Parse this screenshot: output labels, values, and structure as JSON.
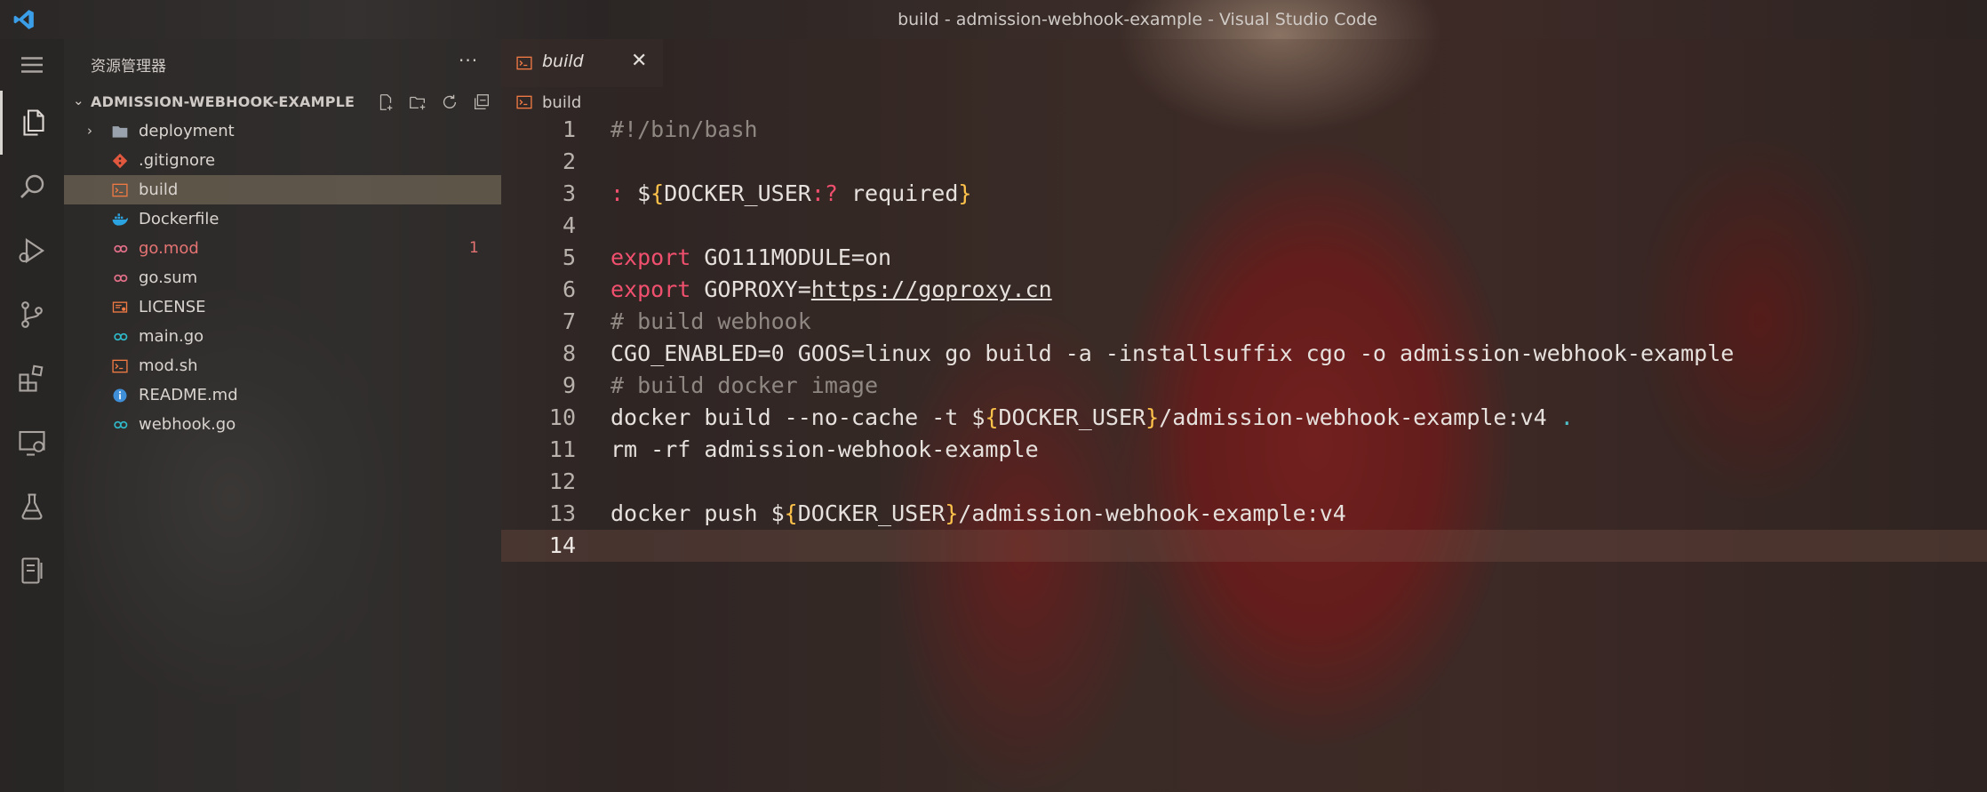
{
  "window": {
    "title": "build - admission-webhook-example - Visual Studio Code"
  },
  "sidebar": {
    "title": "资源管理器",
    "more_label": "···",
    "project": "ADMISSION-WEBHOOK-EXAMPLE",
    "items": [
      {
        "label": "deployment",
        "type": "folder",
        "icon": "folder-icon"
      },
      {
        "label": ".gitignore",
        "type": "git",
        "icon": "git-icon"
      },
      {
        "label": "build",
        "type": "shell",
        "icon": "terminal-icon",
        "selected": true
      },
      {
        "label": "Dockerfile",
        "type": "docker",
        "icon": "docker-icon"
      },
      {
        "label": "go.mod",
        "type": "go-mod",
        "icon": "go-icon",
        "error": true,
        "badge": "1"
      },
      {
        "label": "go.sum",
        "type": "go-mod",
        "icon": "go-icon"
      },
      {
        "label": "LICENSE",
        "type": "license",
        "icon": "license-icon"
      },
      {
        "label": "main.go",
        "type": "go",
        "icon": "go-icon"
      },
      {
        "label": "mod.sh",
        "type": "shell",
        "icon": "terminal-icon"
      },
      {
        "label": "README.md",
        "type": "info",
        "icon": "info-icon"
      },
      {
        "label": "webhook.go",
        "type": "go",
        "icon": "go-icon"
      }
    ]
  },
  "editor": {
    "tab": {
      "label": "build",
      "close": "✕"
    },
    "breadcrumb": "build",
    "current_line": 14,
    "lines": [
      {
        "n": "1",
        "text": "#!/bin/bash"
      },
      {
        "n": "2",
        "text": ""
      },
      {
        "n": "3",
        "text": ": ${DOCKER_USER:? required}"
      },
      {
        "n": "4",
        "text": ""
      },
      {
        "n": "5",
        "text": "export GO111MODULE=on"
      },
      {
        "n": "6",
        "text": "export GOPROXY=https://goproxy.cn"
      },
      {
        "n": "7",
        "text": "# build webhook"
      },
      {
        "n": "8",
        "text": "CGO_ENABLED=0 GOOS=linux go build -a -installsuffix cgo -o admission-webhook-example"
      },
      {
        "n": "9",
        "text": "# build docker image"
      },
      {
        "n": "10",
        "text": "docker build --no-cache -t ${DOCKER_USER}/admission-webhook-example:v4 ."
      },
      {
        "n": "11",
        "text": "rm -rf admission-webhook-example"
      },
      {
        "n": "12",
        "text": ""
      },
      {
        "n": "13",
        "text": "docker push ${DOCKER_USER}/admission-webhook-example:v4"
      },
      {
        "n": "14",
        "text": ""
      }
    ]
  },
  "colors": {
    "keyword": "#f0506e",
    "brace": "#ffc24a",
    "comment": "#8f8782",
    "accent": "#3b9ee8"
  }
}
